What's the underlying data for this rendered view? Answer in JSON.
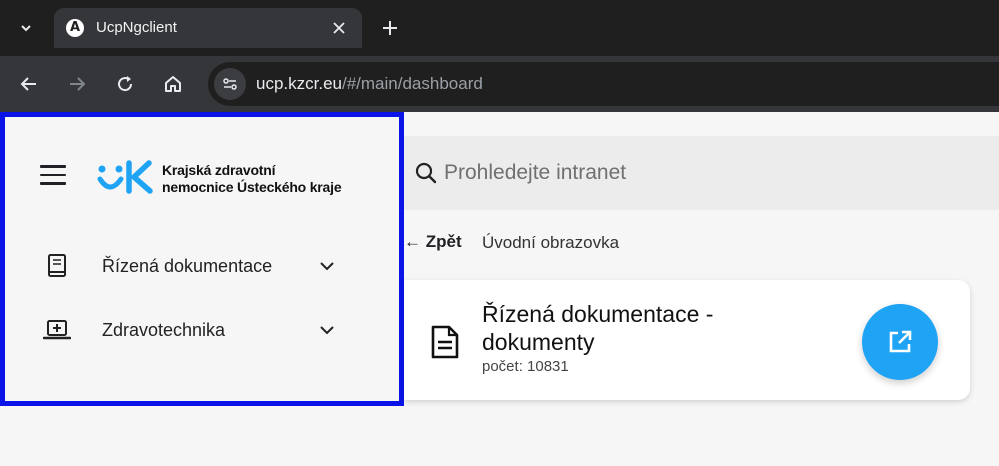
{
  "browser": {
    "tab_title": "UcpNgclient",
    "tab_favicon_letter": "A",
    "url_host": "ucp.kzcr.eu",
    "url_path": "/#/main/dashboard"
  },
  "sidebar": {
    "logo_text_line1": "Krajská zdravotní",
    "logo_text_line2": "nemocnice Ústeckého kraje",
    "items": [
      {
        "label": "Řízená dokumentace",
        "icon": "book-icon"
      },
      {
        "label": "Zdravotechnika",
        "icon": "laptop-plus-icon"
      }
    ],
    "highlight_color": "#0a14e8"
  },
  "search": {
    "placeholder": "Prohledejte intranet"
  },
  "breadcrumb": {
    "back_label": "Zpět",
    "current": "Úvodní obrazovka"
  },
  "card": {
    "title": "Řízená dokumentace - dokumenty",
    "count_label": "počet: 10831",
    "icon": "document-icon",
    "action_icon": "open-external-icon",
    "accent_color": "#1fa3f5"
  }
}
